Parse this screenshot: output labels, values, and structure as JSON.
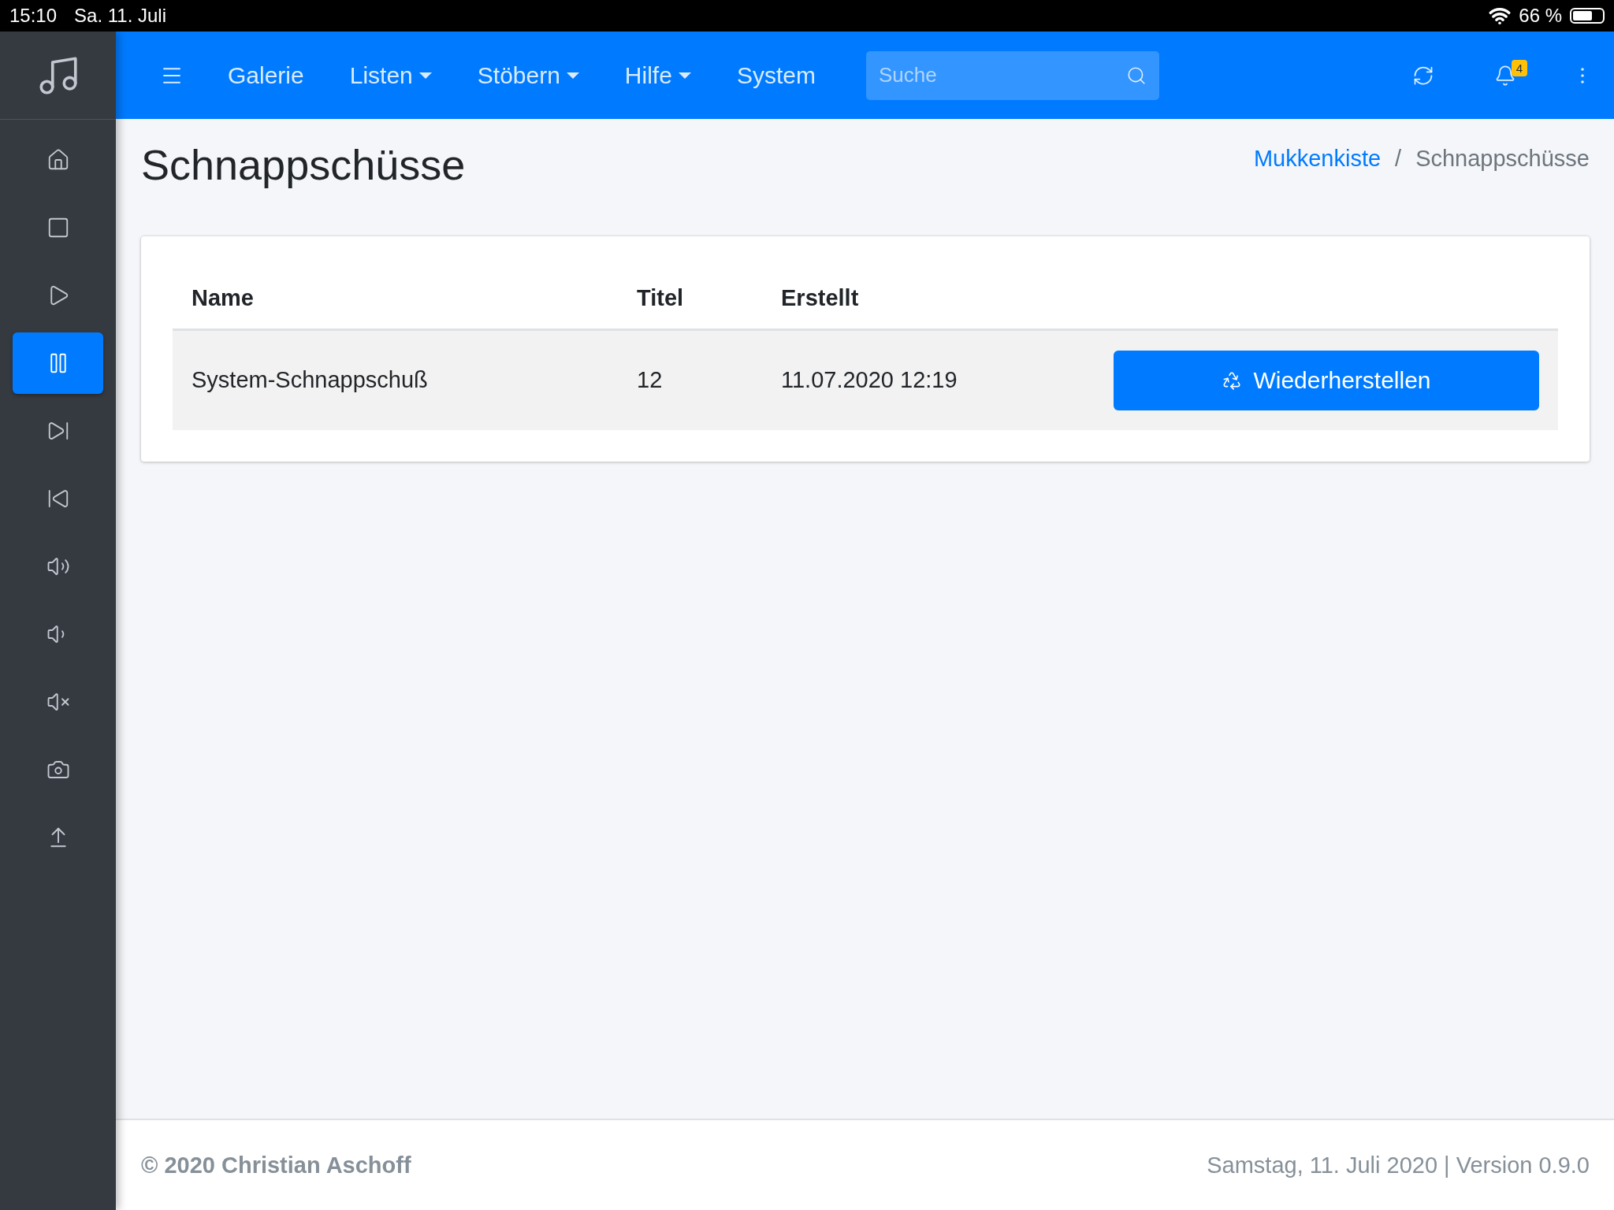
{
  "status_bar": {
    "time": "15:10",
    "date": "Sa. 11. Juli",
    "battery": "66 %"
  },
  "navbar": {
    "items": [
      {
        "label": "Galerie",
        "dropdown": false
      },
      {
        "label": "Listen",
        "dropdown": true
      },
      {
        "label": "Stöbern",
        "dropdown": true
      },
      {
        "label": "Hilfe",
        "dropdown": true
      },
      {
        "label": "System",
        "dropdown": false
      }
    ],
    "search": {
      "placeholder": "Suche"
    },
    "notifications": "4"
  },
  "sidebar": {
    "items": [
      {
        "selected": false
      },
      {
        "selected": false
      },
      {
        "selected": false
      },
      {
        "selected": true
      },
      {
        "selected": false
      },
      {
        "selected": false
      },
      {
        "selected": false
      },
      {
        "selected": false
      },
      {
        "selected": false
      },
      {
        "selected": false
      },
      {
        "selected": false
      }
    ]
  },
  "page": {
    "title": "Schnappschüsse",
    "breadcrumb_separator": "/",
    "breadcrumb": [
      {
        "label": "Mukkenkiste",
        "kind": "link"
      },
      {
        "label": "Schnappschüsse",
        "kind": "current"
      }
    ]
  },
  "table": {
    "columns": [
      "Name",
      "Titel",
      "Erstellt"
    ],
    "rows": [
      {
        "cells": [
          "System-Schnappschuß",
          "12",
          "11.07.2020 12:19"
        ],
        "action": "Wiederherstellen"
      }
    ]
  },
  "footer": {
    "copyright": "© 2020 Christian Aschoff",
    "info": "Samstag, 11. Juli 2020 | Version 0.9.0"
  }
}
